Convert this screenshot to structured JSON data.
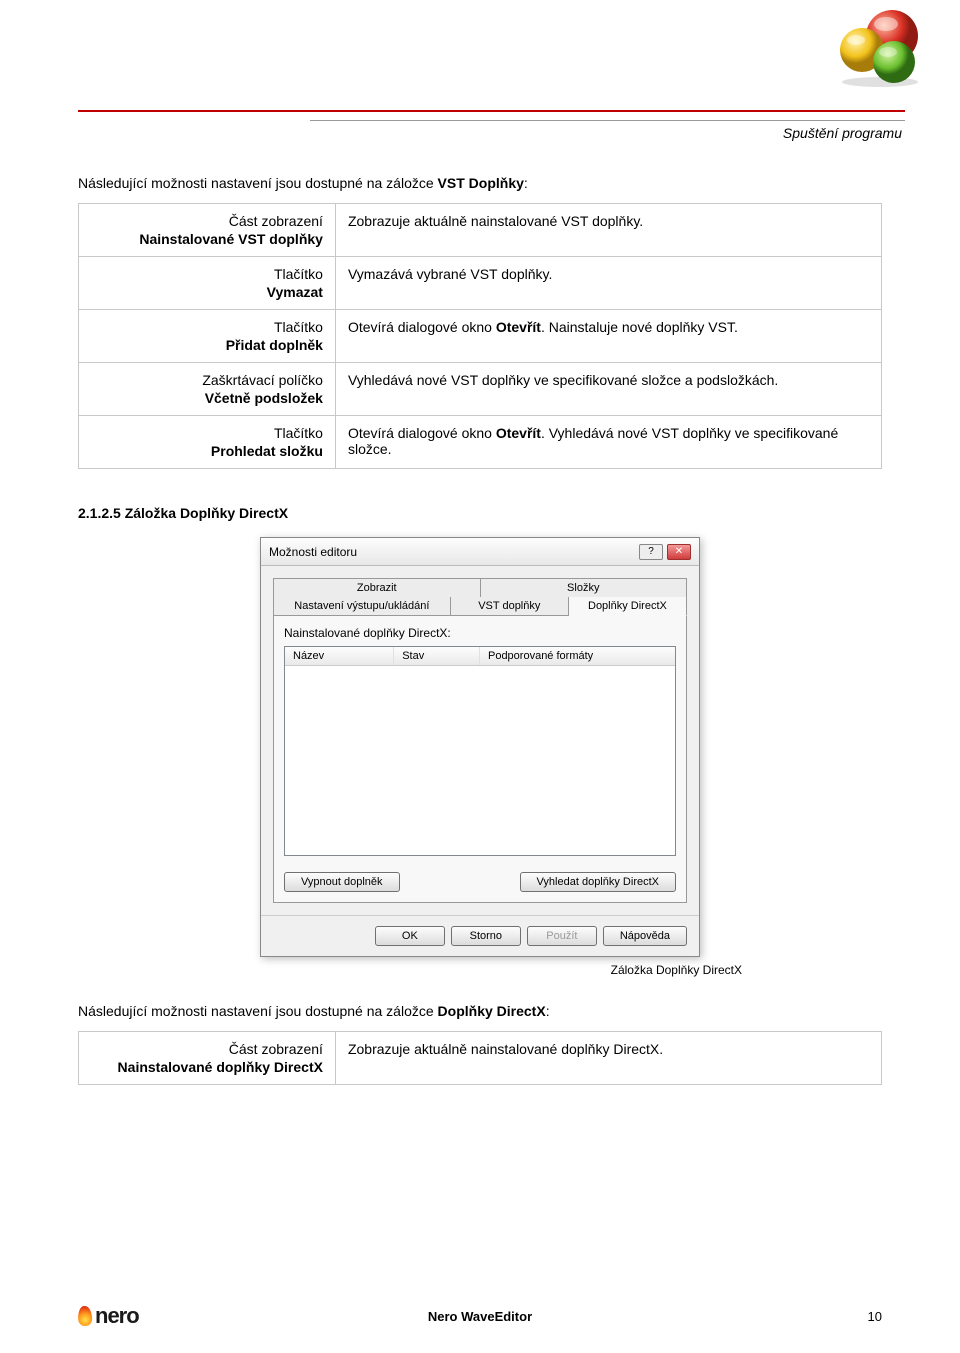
{
  "header": {
    "section_label": "Spuštění programu"
  },
  "intro1": "Následující možnosti nastavení jsou dostupné na záložce VST Doplňky:",
  "table1": {
    "r1": {
      "l1": "Část zobrazení",
      "l2": "Nainstalované VST doplňky",
      "r": "Zobrazuje aktuálně nainstalované VST doplňky."
    },
    "r2": {
      "l1": "Tlačítko",
      "l2": "Vymazat",
      "r": "Vymazává vybrané VST doplňky."
    },
    "r3": {
      "l1": "Tlačítko",
      "l2": "Přidat doplněk",
      "r_pre": "Otevírá dialogové okno ",
      "r_bold": "Otevřít",
      "r_post": ". Nainstaluje nové doplňky VST."
    },
    "r4": {
      "l1": "Zaškrtávací políčko",
      "l2": "Včetně podsložek",
      "r": "Vyhledává nové VST doplňky ve specifikované složce a podsložkách."
    },
    "r5": {
      "l1": "Tlačítko",
      "l2": "Prohledat složku",
      "r_pre": "Otevírá dialogové okno ",
      "r_bold": "Otevřít",
      "r_post": ". Vyhledává nové VST doplňky ve specifikované složce."
    }
  },
  "section_heading": "2.1.2.5  Záložka Doplňky DirectX",
  "dialog": {
    "title": "Možnosti editoru",
    "tabs_top": {
      "t1": "Zobrazit",
      "t2": "Složky"
    },
    "tabs_bottom": {
      "t1": "Nastavení výstupu/ukládání",
      "t2": "VST doplňky",
      "t3": "Doplňky DirectX"
    },
    "panel_label": "Nainstalované doplňky DirectX:",
    "cols": {
      "c1": "Název",
      "c2": "Stav",
      "c3": "Podporované formáty"
    },
    "btn_off": "Vypnout doplněk",
    "btn_find": "Vyhledat doplňky DirectX",
    "footer": {
      "ok": "OK",
      "cancel": "Storno",
      "apply": "Použít",
      "help": "Nápověda"
    }
  },
  "caption": "Záložka Doplňky DirectX",
  "intro2": "Následující možnosti nastavení jsou dostupné na záložce Doplňky DirectX:",
  "table2": {
    "r1": {
      "l1": "Část zobrazení",
      "l2": "Nainstalované doplňky DirectX",
      "r": "Zobrazuje aktuálně nainstalované doplňky DirectX."
    }
  },
  "footer": {
    "product": "Nero WaveEditor",
    "page": "10"
  }
}
